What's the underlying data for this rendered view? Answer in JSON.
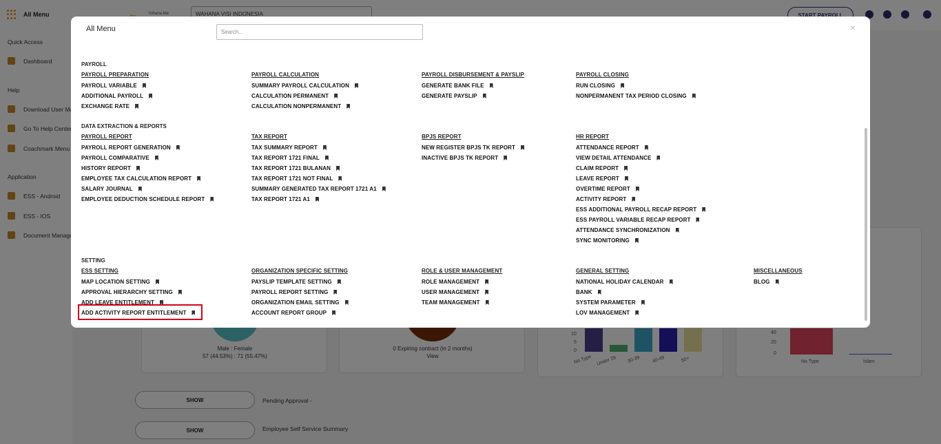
{
  "sidebar": {
    "title": "All Menu",
    "sections": {
      "quick_access": "Quick Access",
      "help": "Help",
      "application": "Application"
    },
    "items": [
      {
        "label": "Dashboard",
        "icon": "home-icon"
      },
      {
        "label": "Download User Ma",
        "icon": "download-icon"
      },
      {
        "label": "Go To Help Center",
        "icon": "help-circle-icon"
      },
      {
        "label": "Coachmark Menu",
        "icon": "lightbulb-icon"
      },
      {
        "label": "ESS - Android",
        "icon": "android-icon"
      },
      {
        "label": "ESS - IOS",
        "icon": "apple-icon"
      },
      {
        "label": "Document Manage",
        "icon": "document-icon"
      }
    ]
  },
  "topbar": {
    "company": "WAHANA VISI INDONESIA",
    "logo_text": "Yohana Me",
    "start_payroll": "START PAYROLL"
  },
  "dashboard": {
    "gender_text": "Male : Female",
    "gender_values": "57 (44.53%) : 71 (55.47%)",
    "contract_text": "0 Expiring contract (in 2 months)",
    "contract_view": "View",
    "age_ticks": [
      "10",
      "5",
      "0"
    ],
    "age_categories": [
      "No Type",
      "Under 29",
      "30-39",
      "40-49",
      "50+"
    ],
    "religion_ticks": [
      "40",
      "20",
      "0"
    ],
    "religion_categories": [
      "No Type",
      "Islam"
    ],
    "show_label": "SHOW",
    "pending_label": "Pending Approval -",
    "ess_summary_label": "Employee Self Service Summary"
  },
  "modal": {
    "title": "All Menu",
    "search_placeholder": "Search...",
    "close": "×",
    "sections": [
      {
        "title": "PAYROLL",
        "columns": [
          {
            "heading": "PAYROLL PREPARATION",
            "items": [
              "PAYROLL VARIABLE",
              "ADDITIONAL PAYROLL",
              "EXCHANGE RATE"
            ]
          },
          {
            "heading": "PAYROLL CALCULATION",
            "items": [
              "SUMMARY PAYROLL CALCULATION",
              "CALCULATION PERMANENT",
              "CALCULATION NONPERMANENT"
            ]
          },
          {
            "heading": "PAYROLL DISBURSEMENT & PAYSLIP",
            "items": [
              "GENERATE BANK FILE",
              "GENERATE PAYSLIP"
            ]
          },
          {
            "heading": "PAYROLL CLOSING",
            "items": [
              "RUN CLOSING",
              "NONPERMANENT TAX PERIOD CLOSING"
            ]
          }
        ]
      },
      {
        "title": "DATA EXTRACTION & REPORTS",
        "columns": [
          {
            "heading": "PAYROLL REPORT",
            "items": [
              "PAYROLL REPORT GENERATION",
              "PAYROLL COMPARATIVE",
              "HISTORY REPORT",
              "EMPLOYEE TAX CALCULATION REPORT",
              "SALARY JOURNAL",
              "EMPLOYEE DEDUCTION SCHEDULE REPORT"
            ]
          },
          {
            "heading": "TAX REPORT",
            "items": [
              "TAX SUMMARY REPORT",
              "TAX REPORT 1721 FINAL",
              "TAX REPORT 1721 BULANAN",
              "TAX REPORT 1721 NOT FINAL",
              "SUMMARY GENERATED TAX REPORT 1721 A1",
              "TAX REPORT 1721 A1"
            ]
          },
          {
            "heading": "BPJS REPORT",
            "items": [
              "NEW REGISTER BPJS TK REPORT",
              "INACTIVE BPJS TK REPORT"
            ]
          },
          {
            "heading": "HR REPORT",
            "items": [
              "ATTENDANCE REPORT",
              "VIEW DETAIL ATTENDANCE",
              "CLAIM REPORT",
              "LEAVE REPORT",
              "OVERTIME REPORT",
              "ACTIVITY REPORT",
              "ESS ADDITIONAL PAYROLL RECAP REPORT",
              "ESS PAYROLL VARIABLE RECAP REPORT",
              "ATTENDANCE SYNCHRONIZATION",
              "SYNC MONITORING"
            ]
          }
        ]
      },
      {
        "title": "SETTING",
        "columns": [
          {
            "heading": "ESS SETTING",
            "items": [
              "MAP LOCATION SETTING",
              "APPROVAL HIERARCHY SETTING",
              "ADD LEAVE ENTITLEMENT",
              "ADD ACTIVITY REPORT ENTITLEMENT"
            ]
          },
          {
            "heading": "ORGANIZATION SPECIFIC SETTING",
            "items": [
              "PAYSLIP TEMPLATE SETTING",
              "PAYROLL REPORT SETTING",
              "ORGANIZATION EMAIL SETTING",
              "ACCOUNT REPORT GROUP"
            ]
          },
          {
            "heading": "ROLE & USER MANAGEMENT",
            "items": [
              "ROLE MANAGEMENT",
              "USER MANAGEMENT",
              "TEAM MANAGEMENT"
            ]
          },
          {
            "heading": "GENERAL SETTING",
            "items": [
              "NATIONAL HOLIDAY CALENDAR",
              "BANK",
              "SYSTEM PARAMETER",
              "LOV MANAGEMENT"
            ]
          },
          {
            "heading": "MISCELLANEOUS",
            "items": [
              "BLOG"
            ]
          }
        ]
      }
    ]
  }
}
